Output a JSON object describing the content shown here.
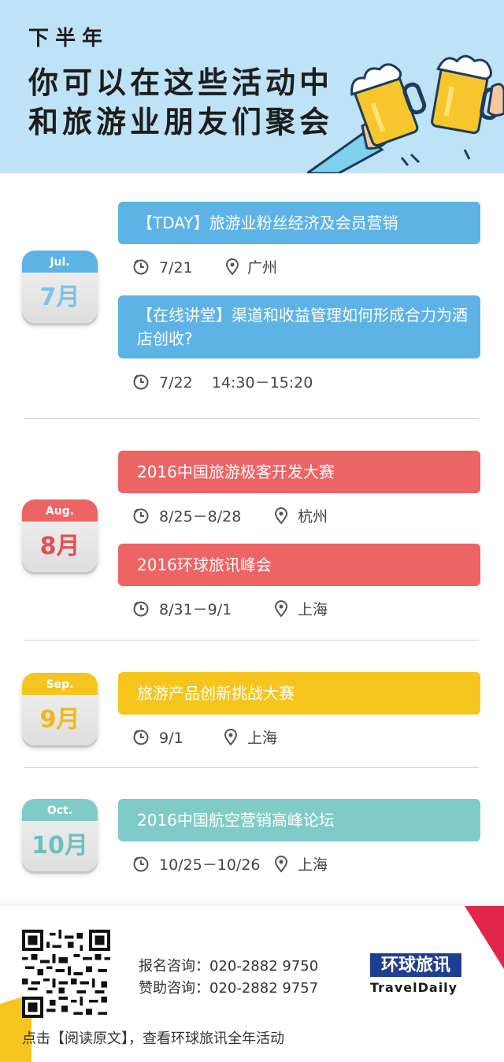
{
  "header": {
    "line1": "下半年",
    "line2": "你可以在这些活动中",
    "line3": "和旅游业朋友们聚会"
  },
  "colors": {
    "header_bg": "#bfe3f6",
    "july": "#5db3e6",
    "aug": "#ec6464",
    "sep": "#f5c51d",
    "oct": "#7fcbc8"
  },
  "months": [
    {
      "abbr": "Jul.",
      "label": "7月",
      "events": [
        {
          "title": "【TDAY】旅游业粉丝经济及会员营销",
          "date": "7/21",
          "location": "广州"
        },
        {
          "title": "【在线讲堂】渠道和收益管理如何形成合力为酒店创收?",
          "date": "7/22    14:30－15:20",
          "location": ""
        }
      ]
    },
    {
      "abbr": "Aug.",
      "label": "8月",
      "events": [
        {
          "title": "2016中国旅游极客开发大赛",
          "date": "8/25－8/28",
          "location": "杭州"
        },
        {
          "title": "2016环球旅讯峰会",
          "date": "8/31－9/1",
          "location": "上海"
        }
      ]
    },
    {
      "abbr": "Sep.",
      "label": "9月",
      "events": [
        {
          "title": "旅游产品创新挑战大赛",
          "date": "9/1",
          "location": "上海"
        }
      ]
    },
    {
      "abbr": "Oct.",
      "label": "10月",
      "events": [
        {
          "title": "2016中国航空营销高峰论坛",
          "date": "10/25－10/26",
          "location": "上海"
        }
      ]
    }
  ],
  "footer": {
    "signup": "报名咨询：020-2882 9750",
    "sponsor": "赞助咨询：020-2882 9757",
    "logo_cn": "环球旅讯",
    "logo_en": "TravelDaily",
    "note": "点击【阅读原文】，查看环球旅讯全年活动"
  },
  "icons": {
    "time": "clock-icon",
    "place": "location-pin-icon"
  }
}
